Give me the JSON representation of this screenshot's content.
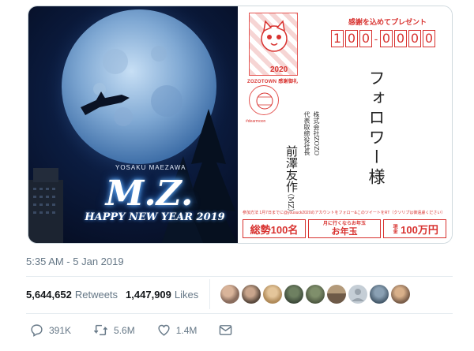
{
  "photo": {
    "caption_name": "YOSAKU MAEZAWA",
    "title": "M.Z.",
    "greeting": "HAPPY NEW YEAR 2019"
  },
  "postcard": {
    "gratitude": "感謝を込めてプレゼント",
    "postal_code": [
      "1",
      "0",
      "0",
      "0",
      "0",
      "0",
      "0"
    ],
    "stamp_year": "2020",
    "stamp_label": "ZOZOTOWN 感謝御礼",
    "postmark_hashtag": "#dearmoon",
    "addressee": "フォロワー様",
    "sender_company": "株式会社ZOZO",
    "sender_title": "代表取締役社長",
    "sender_name": "前澤友作",
    "sender_initials": "（MZ）",
    "campaign_note": "参加方法 1月7日までに@yousuck2020のアカウントをフォロー&このツイートをRT（クソリプは御遠慮ください）",
    "prize_total": "総勢100名",
    "prize_otoshidama_small": "月に行くならお年玉",
    "prize_otoshidama_big": "お年玉",
    "prize_amount_tag": "現金",
    "prize_amount": "100万円"
  },
  "tweet": {
    "timestamp": "5:35 AM - 5 Jan 2019",
    "retweets_count": "5,644,652",
    "retweets_label": "Retweets",
    "likes_count": "1,447,909",
    "likes_label": "Likes",
    "replies": "391K",
    "retweets_short": "5.6M",
    "likes_short": "1.4M"
  },
  "colors": {
    "accent_red": "#d8322f",
    "meta_gray": "#657786"
  },
  "avatars": [
    {
      "color": "#8a6d5e"
    },
    {
      "color": "#5b4a3e"
    },
    {
      "color": "#b08b5a"
    },
    {
      "color": "#3d4a3a"
    },
    {
      "color": "#4f5a43"
    },
    {
      "color": "#6e5a48"
    },
    {
      "color": "#9aa4ad"
    },
    {
      "color": "#465a6b"
    },
    {
      "color": "#7b5f4b"
    }
  ]
}
